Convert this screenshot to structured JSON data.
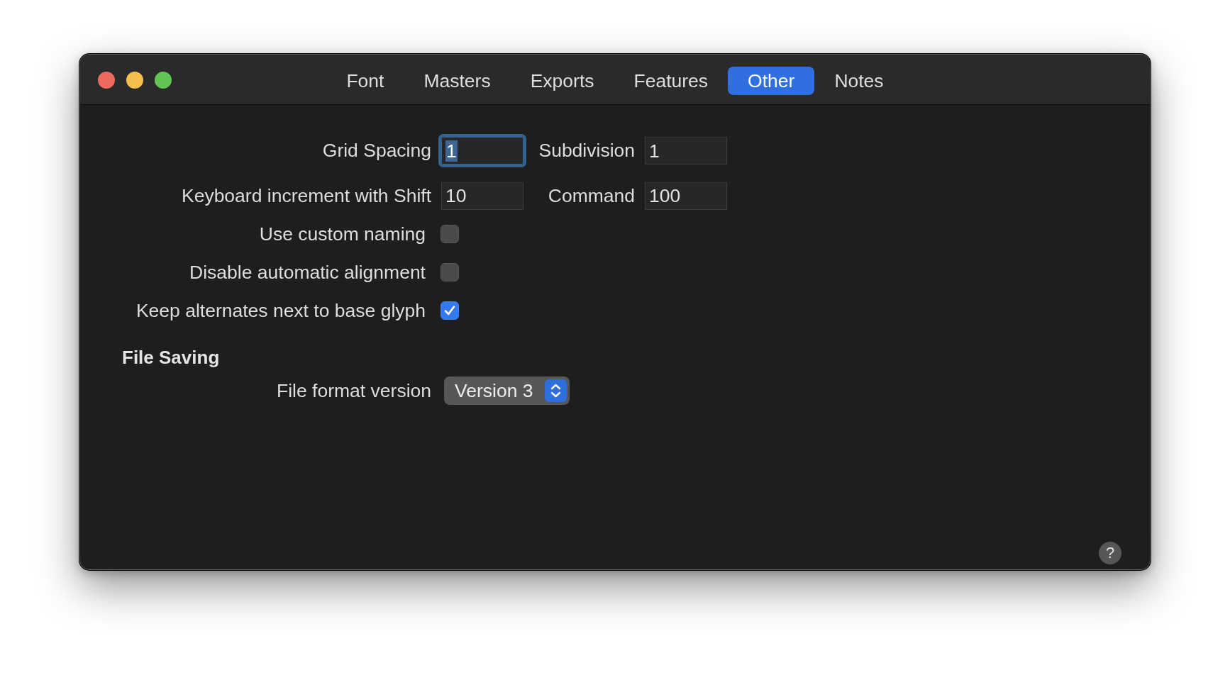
{
  "tabs": [
    {
      "label": "Font",
      "selected": false
    },
    {
      "label": "Masters",
      "selected": false
    },
    {
      "label": "Exports",
      "selected": false
    },
    {
      "label": "Features",
      "selected": false
    },
    {
      "label": "Other",
      "selected": true
    },
    {
      "label": "Notes",
      "selected": false
    }
  ],
  "rows": [
    {
      "kind": "fields",
      "fields": [
        {
          "label": "Grid Spacing",
          "value": "1",
          "focused": true
        },
        {
          "label": "Subdivision",
          "value": "1",
          "focused": false
        }
      ]
    },
    {
      "kind": "fields",
      "fields": [
        {
          "label": "Keyboard increment with Shift",
          "value": "10",
          "focused": false
        },
        {
          "label": "Command",
          "value": "100",
          "focused": false
        }
      ]
    },
    {
      "kind": "checkbox",
      "label": "Use custom naming",
      "checked": false
    },
    {
      "kind": "checkbox",
      "label": "Disable automatic alignment",
      "checked": false
    },
    {
      "kind": "checkbox",
      "label": "Keep alternates next to base glyph",
      "checked": true
    }
  ],
  "sections": [
    {
      "title": "File Saving",
      "rows": [
        {
          "kind": "popup",
          "label": "File format version",
          "value": "Version 3"
        }
      ]
    }
  ],
  "help_button": {
    "label": "?"
  }
}
